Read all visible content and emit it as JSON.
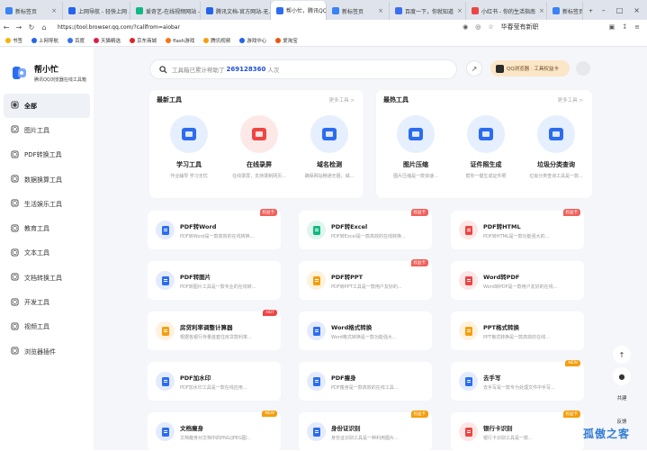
{
  "browser": {
    "tabs": [
      {
        "label": "新标签页",
        "color": "#3b82f6"
      },
      {
        "label": "上网导航 - 轻快上网 ...",
        "color": "#2563eb"
      },
      {
        "label": "爱奇艺-在线视频网站 -",
        "color": "#10b981"
      },
      {
        "label": "腾讯文档-官方网站-无...",
        "color": "#2563eb"
      },
      {
        "label": "帮小忙，腾讯QQ浏览...",
        "color": "#2b6cf0",
        "active": true
      },
      {
        "label": "新标签页",
        "color": "#3b82f6"
      },
      {
        "label": "百度一下，你就知道",
        "color": "#3b6ef0"
      },
      {
        "label": "小红书 - 你的生活指南",
        "color": "#ef4444"
      },
      {
        "label": "新标签页",
        "color": "#3b82f6"
      }
    ],
    "new_tab": "+",
    "url": "https://tool.browser.qq.com/?callfrom=aiobar",
    "address_hint": "华春莹有新职",
    "bookmarks": [
      {
        "label": "书签",
        "color": "#f5b400"
      },
      {
        "label": "上网导航",
        "color": "#2563eb"
      },
      {
        "label": "百度",
        "color": "#3b6ef0"
      },
      {
        "label": "天猫精选",
        "color": "#e11d48"
      },
      {
        "label": "京东商城",
        "color": "#dc2626"
      },
      {
        "label": "flash游戏",
        "color": "#f97316"
      },
      {
        "label": "腾讯视频",
        "color": "#f59e0b"
      },
      {
        "label": "游戏中心",
        "color": "#2563eb"
      },
      {
        "label": "爱淘宝",
        "color": "#ea580c"
      }
    ]
  },
  "brand": {
    "title": "帮小忙",
    "subtitle": "腾讯QQ浏览器在线工具箱"
  },
  "nav": [
    {
      "label": "全部",
      "icon": "grid-icon",
      "active": true
    },
    {
      "label": "图片工具",
      "icon": "image-icon"
    },
    {
      "label": "PDF转换工具",
      "icon": "pdf-icon"
    },
    {
      "label": "数据换算工具",
      "icon": "calc-icon"
    },
    {
      "label": "生活娱乐工具",
      "icon": "life-icon"
    },
    {
      "label": "教育工具",
      "icon": "edu-icon"
    },
    {
      "label": "文本工具",
      "icon": "text-icon"
    },
    {
      "label": "文档转换工具",
      "icon": "doc-icon"
    },
    {
      "label": "开发工具",
      "icon": "dev-icon"
    },
    {
      "label": "视频工具",
      "icon": "video-icon"
    },
    {
      "label": "浏览器插件",
      "icon": "plugin-icon"
    }
  ],
  "search": {
    "prefix": "工具箱已累计帮助了",
    "count": "269128360",
    "suffix": "人次"
  },
  "header_right": {
    "qq_label": "QQ浏览器 · 工具权益卡"
  },
  "latest": {
    "title": "最新工具",
    "more": "更多工具 >",
    "items": [
      {
        "name": "学习工具",
        "desc": "作业辅导 学习无忧",
        "color": "#2b6cf0",
        "bg": "#e6effd"
      },
      {
        "name": "在线录屏",
        "desc": "在线录屏，支持录制网页...",
        "color": "#ef4444",
        "bg": "#fde8e8"
      },
      {
        "name": "域名检测",
        "desc": "确保网站畅通无阻，域...",
        "color": "#2b6cf0",
        "bg": "#e6effd"
      }
    ]
  },
  "hot": {
    "title": "最热工具",
    "more": "更多工具 >",
    "items": [
      {
        "name": "图片压缩",
        "desc": "图片压缩是一款快速...",
        "color": "#2b6cf0",
        "bg": "#e6effd"
      },
      {
        "name": "证件照生成",
        "desc": "帮你一键生成证件照",
        "color": "#2b6cf0",
        "bg": "#e6effd"
      },
      {
        "name": "垃圾分类查询",
        "desc": "垃圾分类查询工具是一款...",
        "color": "#2b6cf0",
        "bg": "#e6effd"
      }
    ]
  },
  "cards": [
    {
      "name": "PDF转Word",
      "desc": "PDF转Word是一款高效的在线转换...",
      "color": "#2b6cf0",
      "badge": "权益卡",
      "badge_color": "#f0615b"
    },
    {
      "name": "PDF转Excel",
      "desc": "PDF转Excel是一款高效的在线转换...",
      "color": "#10b981",
      "badge": "权益卡",
      "badge_color": "#f0615b"
    },
    {
      "name": "PDF转HTML",
      "desc": "PDF转HTML是一款功能强大的...",
      "color": "#ef4444",
      "badge": "权益卡",
      "badge_color": "#f0615b"
    },
    {
      "name": "PDF转图片",
      "desc": "PDF转图片工具是一款专业的在线转...",
      "color": "#2b6cf0",
      "badge": "",
      "badge_color": ""
    },
    {
      "name": "PDF转PPT",
      "desc": "PDF转PPT工具是一款用户友好的...",
      "color": "#f59e0b",
      "badge": "权益卡",
      "badge_color": "#f0615b"
    },
    {
      "name": "Word转PDF",
      "desc": "Word转PDF是一款用户友好的在线...",
      "color": "#ef4444",
      "badge": "",
      "badge_color": ""
    },
    {
      "name": "房贷利率调整计算器",
      "desc": "根据各银行存量首套住房贷款利率...",
      "color": "#f59e0b",
      "badge": "HOT",
      "badge_color": "#ef4444"
    },
    {
      "name": "Word格式转换",
      "desc": "Word格式转换是一款功能强大...",
      "color": "#2b6cf0",
      "badge": "",
      "badge_color": ""
    },
    {
      "name": "PPT格式转换",
      "desc": "PPT格式转换是一款高效的在线...",
      "color": "#f59e0b",
      "badge": "",
      "badge_color": ""
    },
    {
      "name": "PDF加水印",
      "desc": "PDF加水印工具是一款在线应用...",
      "color": "#2b6cf0",
      "badge": "",
      "badge_color": ""
    },
    {
      "name": "PDF瘦身",
      "desc": "PDF瘦身是一款高效的在线工具...",
      "color": "#2b6cf0",
      "badge": "",
      "badge_color": ""
    },
    {
      "name": "去手写",
      "desc": "去手写是一款专为处理文件中手写...",
      "color": "#2b6cf0",
      "badge": "NEW",
      "badge_color": "#f59e0b"
    },
    {
      "name": "文档瘦身",
      "desc": "文档瘦身对文档中的PNG/JPEG图...",
      "color": "#2b6cf0",
      "badge": "NEW",
      "badge_color": "#f59e0b"
    },
    {
      "name": "身份证识别",
      "desc": "身份证识别工具是一种利用图片...",
      "color": "#2b6cf0",
      "badge": "权益卡",
      "badge_color": "#f59e0b"
    },
    {
      "name": "银行卡识别",
      "desc": "银行卡识别工具是一款...",
      "color": "#ef4444",
      "badge": "权益卡",
      "badge_color": "#f59e0b"
    }
  ],
  "float": {
    "top_label": "",
    "bell_label": "",
    "share_label": "共建",
    "feedback_label": "反馈"
  },
  "watermark": "孤傲之客"
}
